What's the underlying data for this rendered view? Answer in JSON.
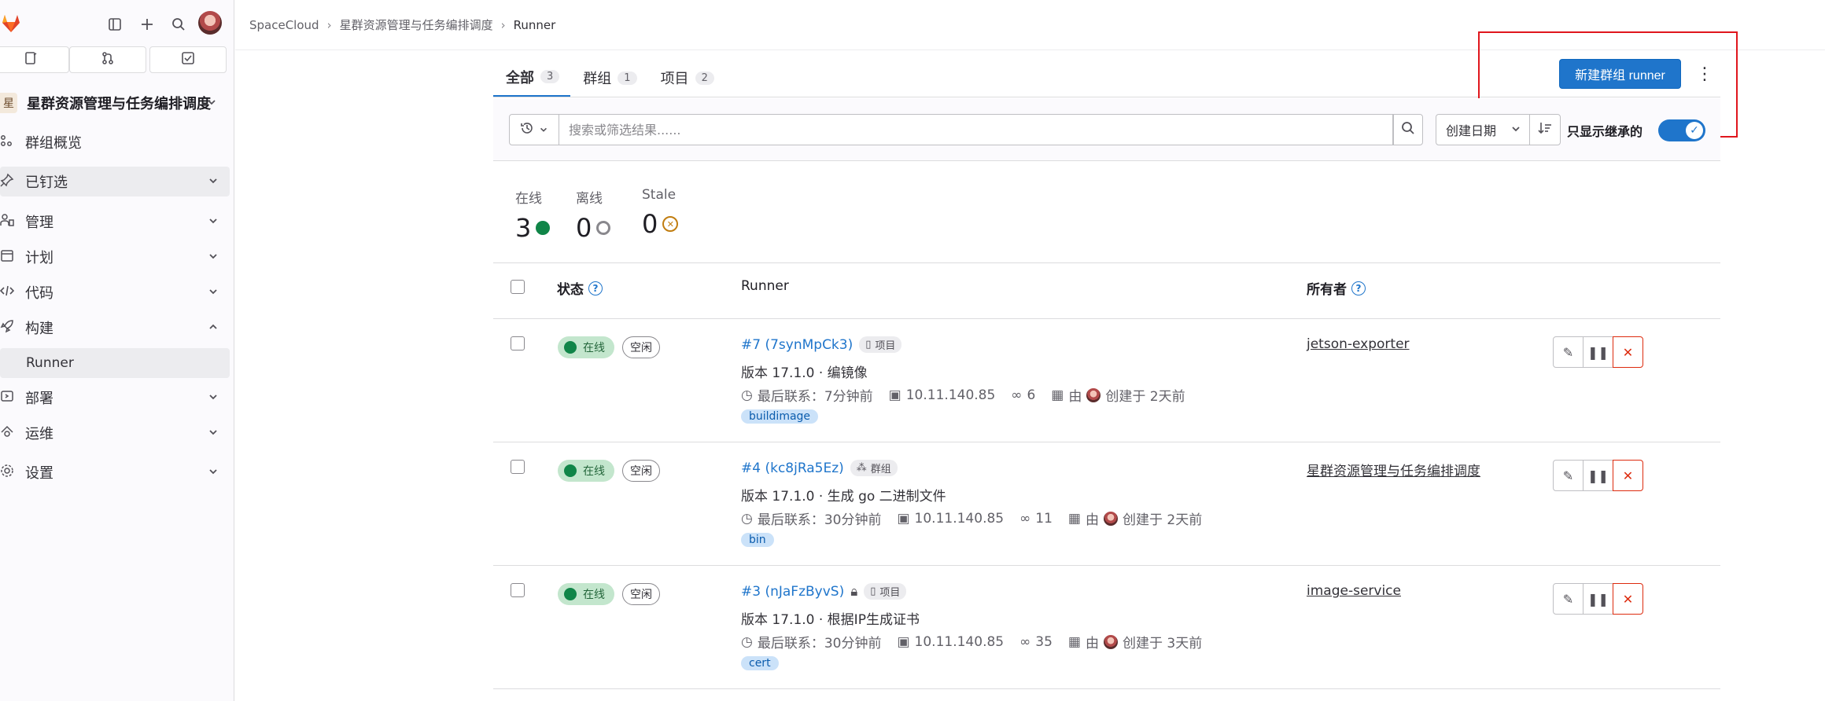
{
  "sidebar": {
    "group_avatar": "星",
    "group_name": "星群资源管理与任务编排调度",
    "items": [
      {
        "label": "群组概览"
      },
      {
        "label": "已钉选"
      },
      {
        "label": "管理"
      },
      {
        "label": "计划"
      },
      {
        "label": "代码"
      },
      {
        "label": "构建"
      },
      {
        "label": "Runner"
      },
      {
        "label": "部署"
      },
      {
        "label": "运维"
      },
      {
        "label": "设置"
      }
    ]
  },
  "breadcrumb": {
    "items": [
      "SpaceCloud",
      "星群资源管理与任务编排调度",
      "Runner"
    ]
  },
  "tabs": [
    {
      "label": "全部",
      "count": "3"
    },
    {
      "label": "群组",
      "count": "1"
    },
    {
      "label": "项目",
      "count": "2"
    }
  ],
  "toolbar": {
    "new_runner_label": "新建群组 runner",
    "kebab": "⋮"
  },
  "filter": {
    "placeholder": "搜索或筛选结果......",
    "sort_label": "创建日期",
    "inherit_label": "只显示继承的",
    "inherit_on": true
  },
  "stats": [
    {
      "label": "在线",
      "value": "3"
    },
    {
      "label": "离线",
      "value": "0"
    },
    {
      "label": "Stale",
      "value": "0"
    }
  ],
  "table": {
    "headers": {
      "status": "状态",
      "runner": "Runner",
      "owner": "所有者"
    },
    "rows": [
      {
        "status": "在线",
        "idle": "空闲",
        "name": "#7 (7synMpCk3)",
        "type": "项目",
        "locked": false,
        "version": "版本 17.1.0 · 编镜像",
        "last_contact": "最后联系：7分钟前",
        "ip": "10.11.140.85",
        "jobs": "6",
        "by": "由",
        "created": "创建于 2天前",
        "tag": "buildimage",
        "owner": "jetson-exporter"
      },
      {
        "status": "在线",
        "idle": "空闲",
        "name": "#4 (kc8jRa5Ez)",
        "type": "群组",
        "locked": false,
        "version": "版本 17.1.0 · 生成 go 二进制文件",
        "last_contact": "最后联系：30分钟前",
        "ip": "10.11.140.85",
        "jobs": "11",
        "by": "由",
        "created": "创建于 2天前",
        "tag": "bin",
        "owner": "星群资源管理与任务编排调度"
      },
      {
        "status": "在线",
        "idle": "空闲",
        "name": "#3 (nJaFzByvS)",
        "type": "项目",
        "locked": true,
        "version": "版本 17.1.0 · 根据IP生成证书",
        "last_contact": "最后联系：30分钟前",
        "ip": "10.11.140.85",
        "jobs": "35",
        "by": "由",
        "created": "创建于 3天前",
        "tag": "cert",
        "owner": "image-service"
      }
    ]
  },
  "colors": {
    "accent": "#1f75cb",
    "online": "#108548",
    "danger": "#dd2b0e",
    "highlight": "#e0161d"
  }
}
